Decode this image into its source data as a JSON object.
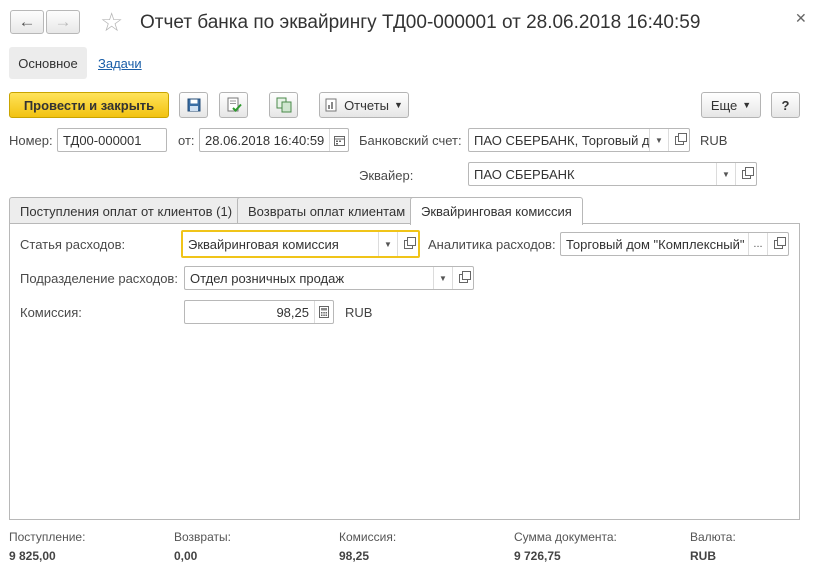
{
  "window": {
    "title": "Отчет банка по эквайрингу ТД00-000001 от 28.06.2018 16:40:59"
  },
  "nav": {
    "back_icon": "arrow-left-icon",
    "forward_icon": "arrow-right-icon",
    "favorite_icon": "star-icon",
    "close_icon": "close-icon"
  },
  "top_tabs": [
    {
      "label": "Основное",
      "active": true
    },
    {
      "label": "Задачи",
      "active": false
    }
  ],
  "toolbar": {
    "post_close_label": "Провести и закрыть",
    "save_icon": "save-icon",
    "post_icon": "post-document-icon",
    "structure_icon": "document-structure-icon",
    "reports_label": "Отчеты",
    "more_label": "Еще",
    "help_label": "?"
  },
  "header": {
    "number_label": "Номер:",
    "number_value": "ТД00-000001",
    "date_label": "от:",
    "date_value": "28.06.2018 16:40:59",
    "bank_account_label": "Банковский счет:",
    "bank_account_value": "ПАО СБЕРБАНК, Торговый д",
    "bank_account_currency": "RUB",
    "acquirer_label": "Эквайер:",
    "acquirer_value": "ПАО СБЕРБАНК"
  },
  "tabs": [
    {
      "label": "Поступления оплат от клиентов (1)",
      "active": false
    },
    {
      "label": "Возвраты оплат клиентам",
      "active": false
    },
    {
      "label": "Эквайринговая комиссия",
      "active": true
    }
  ],
  "commission": {
    "expense_item_label": "Статья расходов:",
    "expense_item_value": "Эквайринговая комиссия",
    "analytics_label": "Аналитика расходов:",
    "analytics_value": "Торговый дом \"Комплексный\"",
    "department_label": "Подразделение расходов:",
    "department_value": "Отдел розничных продаж",
    "commission_label": "Комиссия:",
    "commission_value": "98,25",
    "commission_currency": "RUB"
  },
  "footer": [
    {
      "label": "Поступление:",
      "value": "9 825,00"
    },
    {
      "label": "Возвраты:",
      "value": "0,00"
    },
    {
      "label": "Комиссия:",
      "value": "98,25"
    },
    {
      "label": "Сумма документа:",
      "value": "9 726,75"
    },
    {
      "label": "Валюта:",
      "value": "RUB"
    }
  ]
}
